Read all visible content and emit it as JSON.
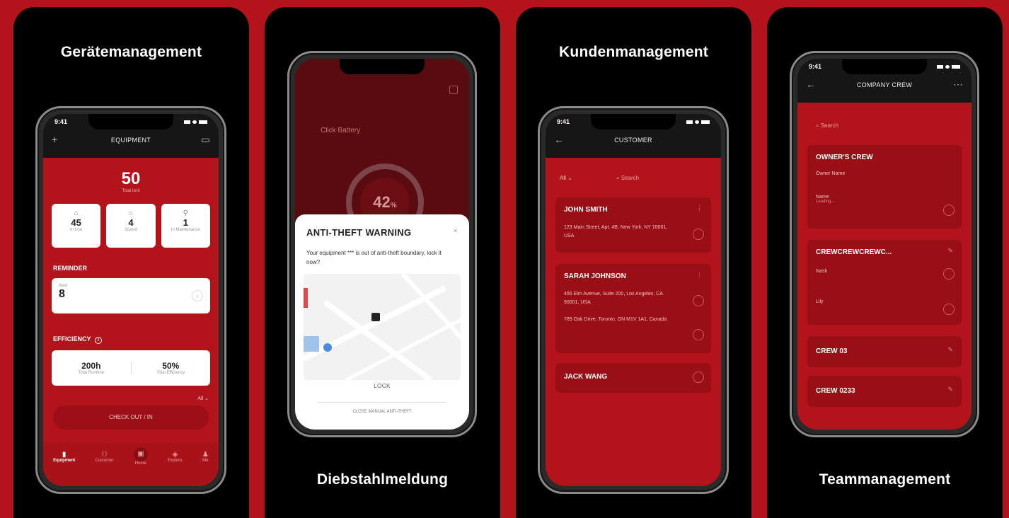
{
  "cards": {
    "c1": {
      "title": "Gerätemanagement"
    },
    "c2": {
      "title": "Diebstahlmeldung"
    },
    "c3": {
      "title": "Kundenmanagement"
    },
    "c4": {
      "title": "Teammanagement"
    }
  },
  "status_time": "9:41",
  "equipment": {
    "header": "EQUIPMENT",
    "total": "50",
    "total_label": "Total Unit",
    "stats": [
      {
        "value": "45",
        "label": "In Use",
        "icon": "home-icon"
      },
      {
        "value": "4",
        "label": "Stored",
        "icon": "home-icon"
      },
      {
        "value": "1",
        "label": "In Maintenance",
        "icon": "wrench-icon"
      }
    ],
    "reminder_label": "REMINDER",
    "alert_label": "Alert",
    "alert_value": "8",
    "efficiency_label": "EFFICIENCY",
    "runtime_value": "200h",
    "runtime_label": "Total Runtime",
    "efficiency_value": "50%",
    "efficiency_sub": "Total Efficiency",
    "filter": "All",
    "checkout_label": "CHECK OUT / IN",
    "nav": [
      {
        "label": "Equipment",
        "icon": "equipment-icon"
      },
      {
        "label": "Customer",
        "icon": "customer-icon"
      },
      {
        "label": "Home",
        "icon": "home-icon"
      },
      {
        "label": "Explore",
        "icon": "explore-icon"
      },
      {
        "label": "Me",
        "icon": "person-icon"
      }
    ]
  },
  "antitheft": {
    "bg_label": "Click Battery",
    "gauge_value": "42",
    "gauge_unit": "%",
    "title": "ANTI-THEFT WARNING",
    "message": "Your equipment *** is out of anti-theft boundary, lock it now?",
    "lock_label": "LOCK",
    "close_label": "CLOSE MANUAL ANTI-THEFT"
  },
  "customer": {
    "header": "CUSTOMER",
    "filter_all": "All",
    "search_placeholder": "Search",
    "list": [
      {
        "name": "JOHN SMITH",
        "addresses": [
          "123 Main Street, Apt. 4B, New York, NY 10001, USA"
        ]
      },
      {
        "name": "SARAH JOHNSON",
        "addresses": [
          "456 Elm Avenue, Suite 200, Los Angeles, CA 90001, USA",
          "789 Oak Drive, Toronto, ON M1V 1A1, Canada"
        ]
      },
      {
        "name": "JACK WANG",
        "addresses": []
      }
    ]
  },
  "crew": {
    "header": "COMPANY CREW",
    "search_placeholder": "Search",
    "owner_title": "OWNER'S CREW",
    "owner_name": "Owner Name",
    "owner_member": "Name",
    "owner_member_sub": "Leading...",
    "crew2_title": "CREWCREWCREWC...",
    "crew2_members": [
      "Nash",
      "Lily"
    ],
    "crew3_title": "CREW 03",
    "crew4_title": "CREW 0233"
  },
  "colors": {
    "brand_red": "#b3141c",
    "dark_red": "#9a0e15",
    "black": "#000000"
  }
}
